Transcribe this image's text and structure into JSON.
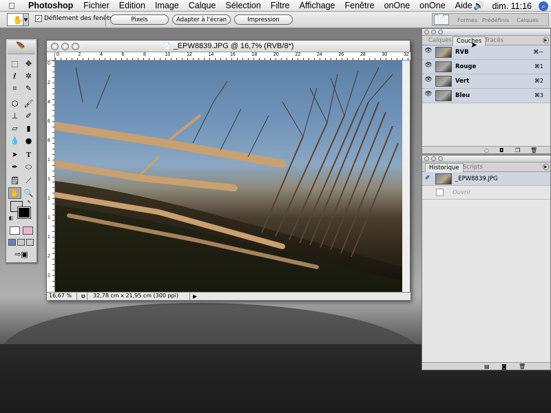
{
  "menubar": {
    "apple": "",
    "app": "Photoshop",
    "items": [
      "Fichier",
      "Edition",
      "Image",
      "Calque",
      "Sélection",
      "Filtre",
      "Affichage",
      "Fenêtre",
      "onOne",
      "onOne",
      "Aide"
    ],
    "clock": "dim. 11:16"
  },
  "options": {
    "scroll_all": "Défilement des fenêtres",
    "btn_pixels": "Pixels",
    "btn_fit": "Adapter à l'écran",
    "btn_print": "Impression",
    "well_formes": "Formes",
    "well_predef": "Prédéfinis",
    "well_calques": "Calques"
  },
  "document": {
    "title": "_EPW8839.JPG @ 16,7% (RVB/8*)",
    "zoom": "16,67 %",
    "info": "32,78 cm x 21,95 cm (300 ppi)",
    "ruler_top": [
      "0",
      "2",
      "4",
      "6",
      "8",
      "10",
      "12",
      "14",
      "16",
      "18",
      "20",
      "22",
      "24",
      "26",
      "28",
      "30",
      "32"
    ],
    "ruler_left": [
      "0",
      "2",
      "4",
      "6",
      "8",
      "1",
      "1",
      "1",
      "1",
      "1",
      "2",
      "2"
    ]
  },
  "channels_panel": {
    "tabs": [
      "Calques",
      "Couches",
      "Tracés"
    ],
    "active_tab": "Couches",
    "rows": [
      {
        "name": "RVB",
        "key": "⌘~"
      },
      {
        "name": "Rouge",
        "key": "⌘1"
      },
      {
        "name": "Vert",
        "key": "⌘2"
      },
      {
        "name": "Bleu",
        "key": "⌘3"
      }
    ]
  },
  "history_panel": {
    "tabs": [
      "Historique",
      "Scripts"
    ],
    "active_tab": "Historique",
    "snapshot": "_EPW8839.JPG",
    "step": "Ouvrir"
  },
  "colors": {
    "selection_row": "#cfd6e2",
    "foreground": "#cfcfcf",
    "background": "#000000"
  }
}
